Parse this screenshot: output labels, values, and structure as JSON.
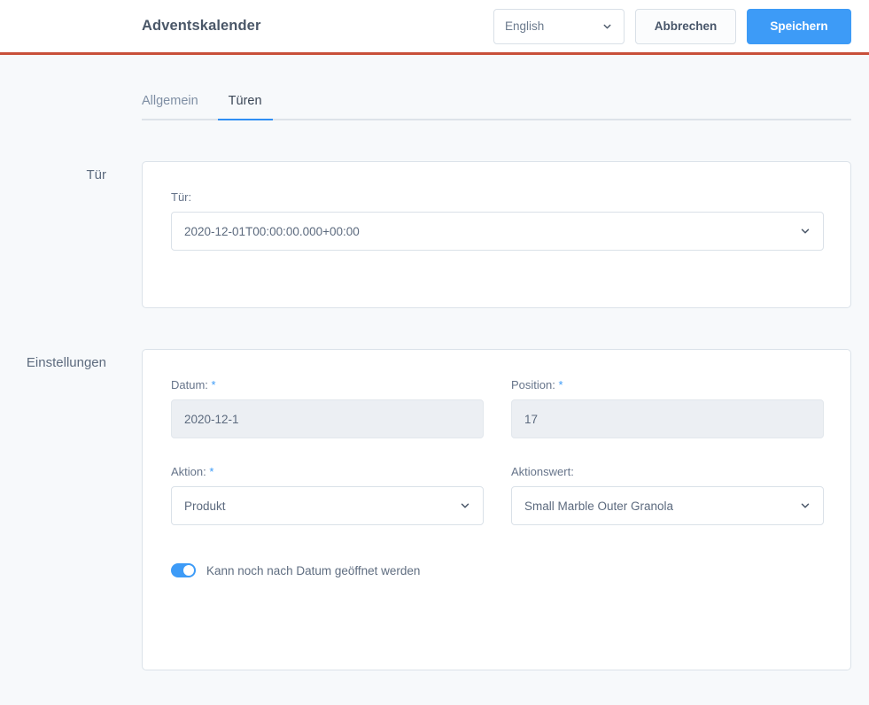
{
  "header": {
    "title": "Adventskalender",
    "language_value": "English",
    "cancel_label": "Abbrechen",
    "save_label": "Speichern"
  },
  "tabs": [
    {
      "label": "Allgemein",
      "active": false
    },
    {
      "label": "Türen",
      "active": true
    }
  ],
  "sections": {
    "door": {
      "section_label": "Tür",
      "field_label": "Tür:",
      "field_value": "2020-12-01T00:00:00.000+00:00"
    },
    "settings": {
      "section_label": "Einstellungen",
      "fields": {
        "datum": {
          "label": "Datum:",
          "required_mark": "*",
          "value": "2020-12-1"
        },
        "position": {
          "label": "Position:",
          "required_mark": "*",
          "value": "17"
        },
        "aktion": {
          "label": "Aktion:",
          "required_mark": "*",
          "value": "Produkt"
        },
        "aktionswert": {
          "label": "Aktionswert:",
          "required_mark": "",
          "value": "Small Marble Outer Granola"
        }
      },
      "toggle": {
        "label": "Kann noch nach Datum geöffnet werden",
        "state": "on"
      }
    }
  },
  "colors": {
    "accent_blue": "#3d9bf7",
    "header_rule": "#c8503a",
    "page_bg": "#f7f9fb",
    "card_border": "#dbe2e9",
    "text_primary": "#4a5768",
    "text_muted": "#7f8fa4"
  }
}
